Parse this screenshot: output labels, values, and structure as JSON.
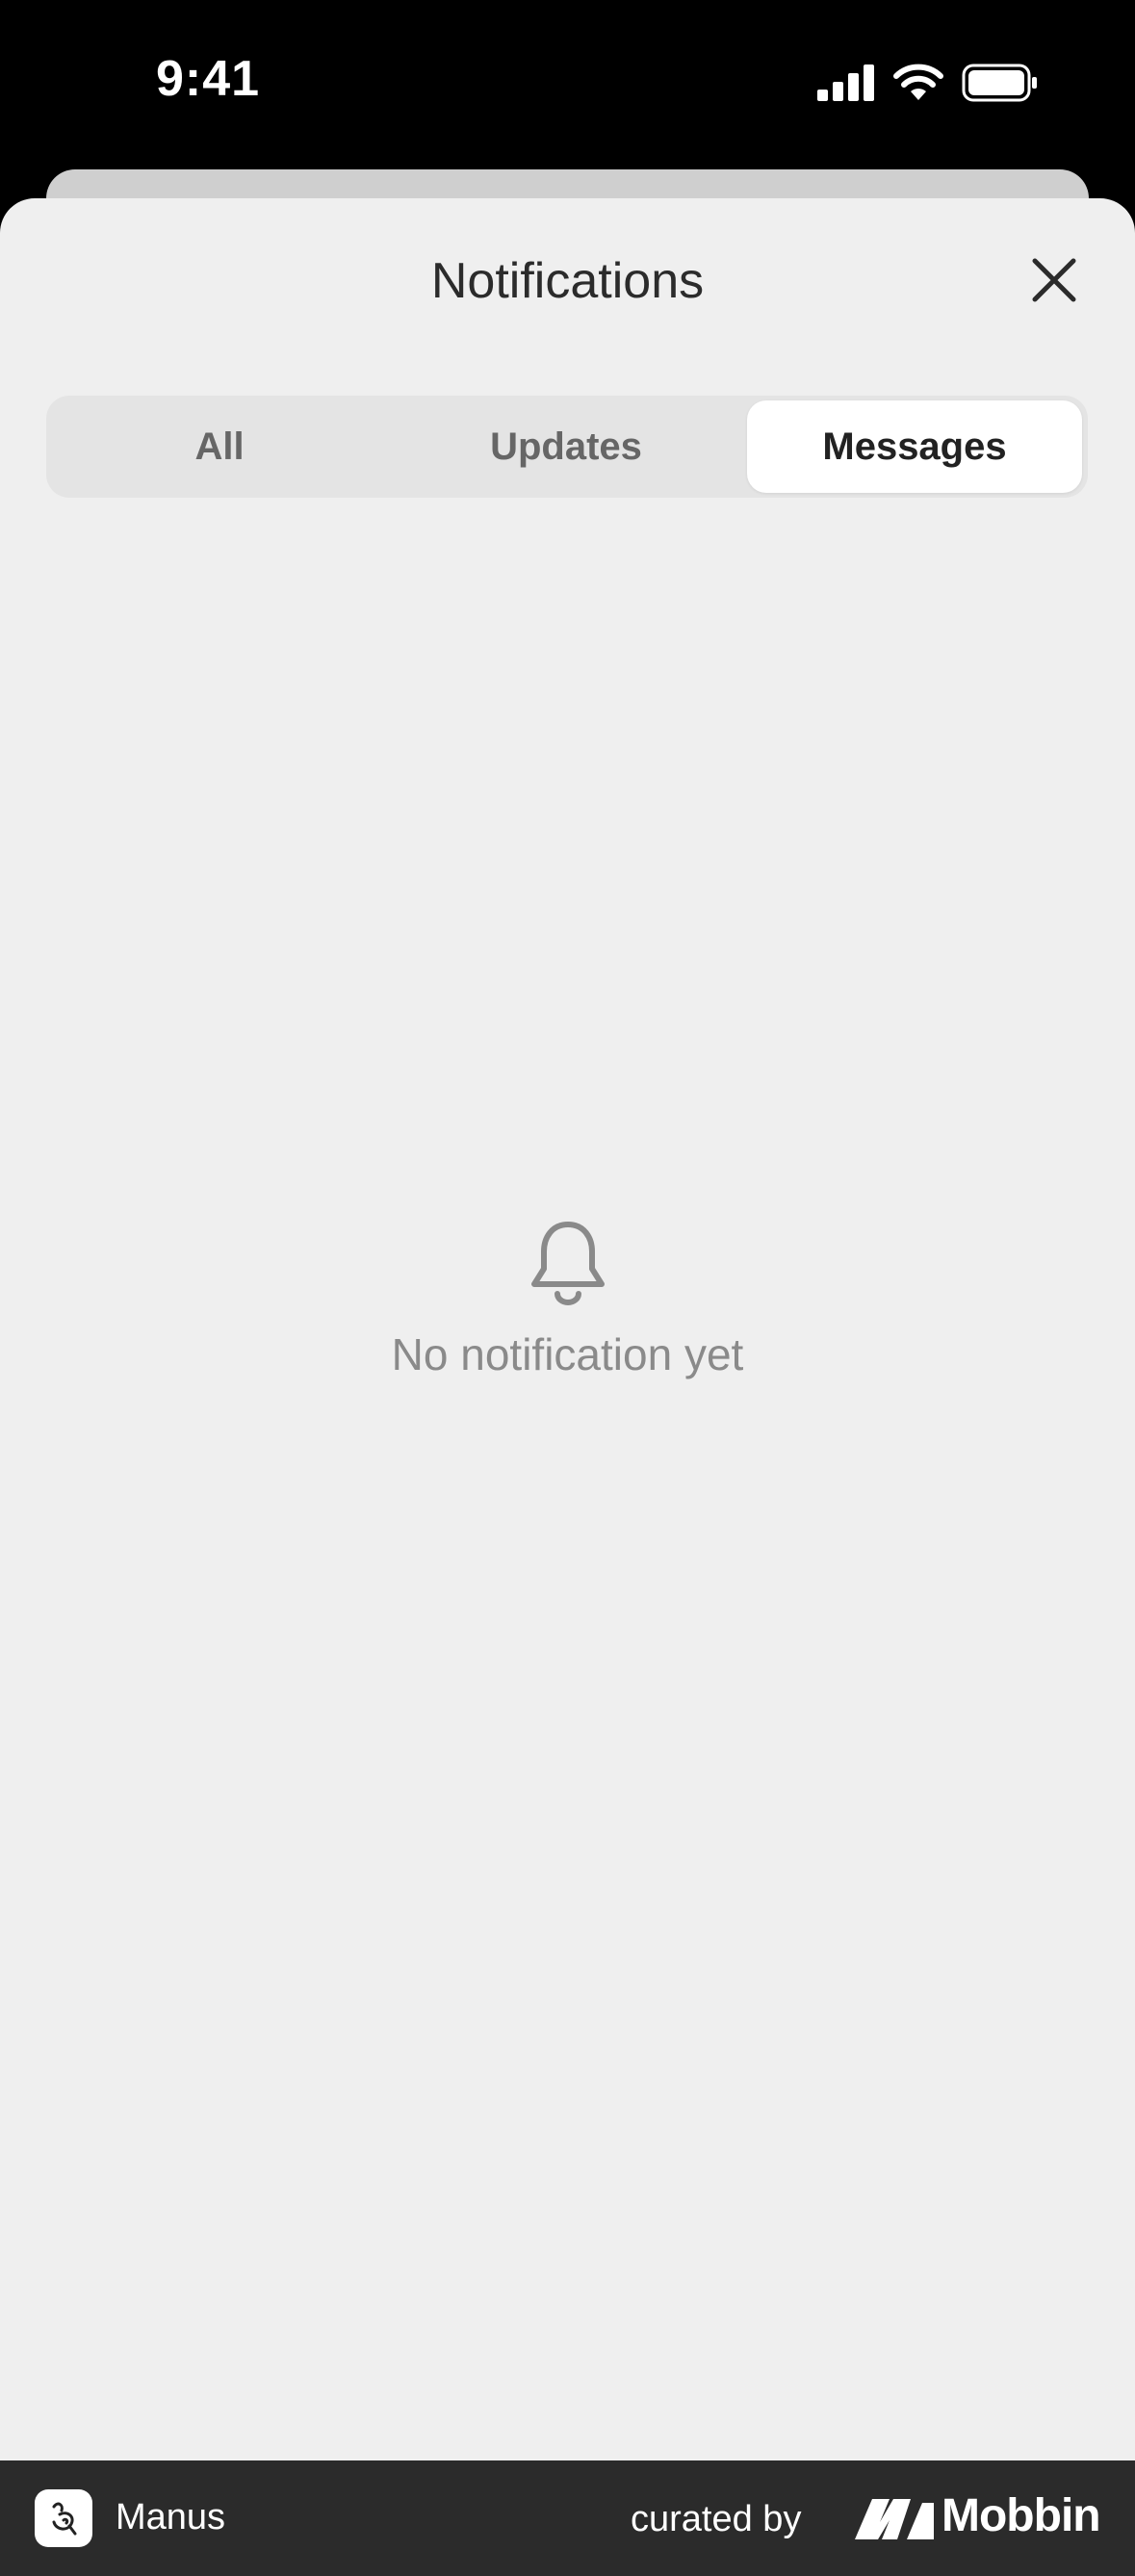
{
  "status_bar": {
    "time": "9:41"
  },
  "sheet": {
    "title": "Notifications"
  },
  "tabs": [
    {
      "label": "All",
      "selected": false
    },
    {
      "label": "Updates",
      "selected": false
    },
    {
      "label": "Messages",
      "selected": true
    }
  ],
  "empty_state": {
    "icon": "bell-icon",
    "text": "No notification yet"
  },
  "footer": {
    "app_name": "Manus",
    "curated_by": "curated by",
    "brand": "Mobbin"
  },
  "colors": {
    "sheet_background": "#efefef",
    "segment_track": "#e4e4e4",
    "segment_selected": "#ffffff",
    "footer_background": "#2b2b2b"
  }
}
